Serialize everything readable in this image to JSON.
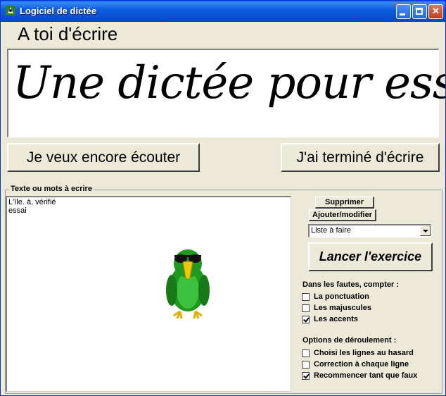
{
  "window": {
    "title": "Logiciel de dictée",
    "controls": {
      "minimize_icon": "minimize-icon",
      "maximize_icon": "maximize-icon",
      "close_icon": "close-icon"
    }
  },
  "dictation": {
    "prompt": "A toi d'écrire",
    "text": "Une dictée pour essayer",
    "listen_button": "Je veux encore écouter",
    "finish_button": "J'ai terminé d'écrire"
  },
  "word_panel": {
    "group_label": "Texte ou mots à ecrire",
    "lines": [
      "L'île. à, vérifié",
      "essai"
    ],
    "mascot_icon": "parrot-with-sunglasses"
  },
  "controls": {
    "delete_button": "Supprimer",
    "edit_button": "Ajouter/modifier",
    "list_select": {
      "value": "Liste à faire"
    },
    "launch_button": "Lancer l'exercice",
    "errors": {
      "title": "Dans les fautes, compter :",
      "options": [
        {
          "label": "La ponctuation",
          "checked": false
        },
        {
          "label": "Les majuscules",
          "checked": false
        },
        {
          "label": "Les accents",
          "checked": true
        }
      ]
    },
    "run_options": {
      "title": "Options de déroulement :",
      "options": [
        {
          "label": "Choisi les lignes au hasard",
          "checked": false
        },
        {
          "label": "Correction à chaque ligne",
          "checked": false
        },
        {
          "label": "Recommencer tant que faux",
          "checked": true
        }
      ]
    }
  },
  "colors": {
    "titlebar": "#0a53d4",
    "face": "#ece9d8",
    "parrot": "#1f9a1f",
    "beak": "#f5c400"
  }
}
